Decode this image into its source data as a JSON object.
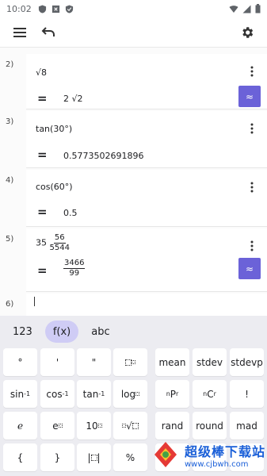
{
  "status_bar": {
    "time": "10:02"
  },
  "entries": [
    {
      "number": "2)",
      "expression": "√8",
      "result": "2 √2",
      "has_approx": true
    },
    {
      "number": "3)",
      "expression": "tan(30°)",
      "result": "0.5773502691896",
      "has_approx": false
    },
    {
      "number": "4)",
      "expression": "cos(60°)",
      "result": "0.5",
      "has_approx": false
    },
    {
      "number": "5)",
      "expression_whole": "35",
      "expression_num": "56",
      "expression_den": "5544",
      "result_num": "3466",
      "result_den": "99",
      "has_approx": true
    },
    {
      "number": "6)"
    }
  ],
  "approx_label": "≈",
  "equals": "=",
  "keyboard": {
    "tabs": [
      "123",
      "f(x)",
      "abc"
    ],
    "active_tab": "f(x)",
    "rows": [
      [
        "°",
        "'",
        "\"",
        "▢",
        "mean",
        "stdev",
        "stdevp"
      ],
      [
        "sin⁻¹",
        "cos⁻¹",
        "tan⁻¹",
        "log▢",
        "ⁿPᵣ",
        "ⁿCᵣ",
        "!"
      ],
      [
        "e",
        "e▢",
        "10▢",
        "▢√▢",
        "rand",
        "round",
        "mad"
      ],
      [
        "{",
        "}",
        "|▢|",
        "%",
        "",
        "",
        ""
      ]
    ]
  },
  "watermark": {
    "line1": "超级棒下载站",
    "line2": "www.cjbwh.com"
  },
  "colors": {
    "accent": "#6b62d8",
    "tab_active_bg": "#cfccf5"
  }
}
